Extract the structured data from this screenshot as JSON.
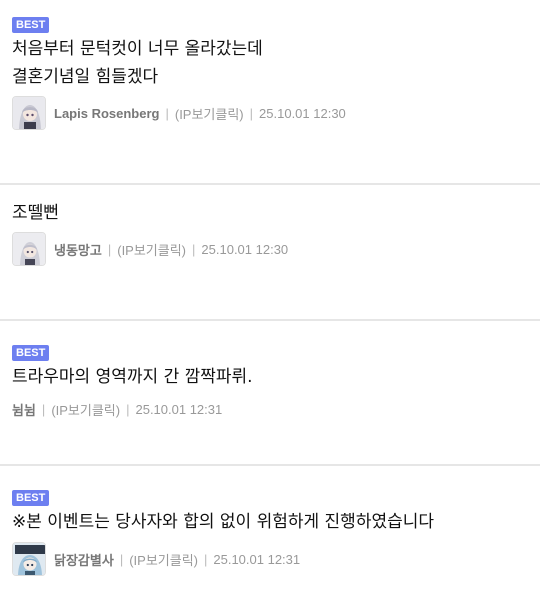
{
  "comments": [
    {
      "best": "BEST",
      "text": "처음부터 문턱컷이 너무 올라갔는데\n결혼기념일 힘들겠다",
      "nickname": "Lapis Rosenberg",
      "ip": "(IP보기클릭)",
      "time": "25.10.01 12:30"
    },
    {
      "text": "조뗄뻔",
      "nickname": "냉동망고",
      "ip": "(IP보기클릭)",
      "time": "25.10.01 12:30"
    },
    {
      "best": "BEST",
      "text": "트라우마의 영역까지 간 깜짝파뤼.",
      "nickname": "뉨뉨",
      "ip": "(IP보기클릭)",
      "time": "25.10.01 12:31"
    },
    {
      "best": "BEST",
      "text": "※본 이벤트는 당사자와 합의 없이 위험하게 진행하였습니다",
      "nickname": "닭장감별사",
      "ip": "(IP보기클릭)",
      "time": "25.10.01 12:31"
    }
  ],
  "colors": {
    "best_badge": "#6d7ff0",
    "divider": "#e6e6e6",
    "meta_text": "#999999"
  },
  "icons": [
    "avatar-anime-girl-icon",
    "avatar-anime-girl-icon",
    "avatar-anime-character-icon"
  ]
}
